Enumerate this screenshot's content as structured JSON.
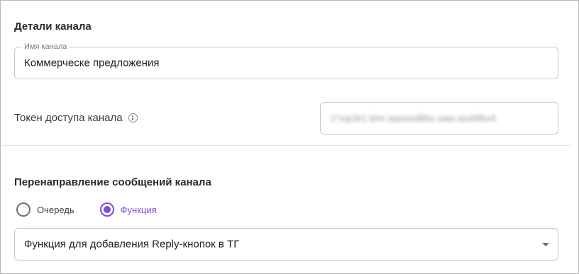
{
  "channel_details": {
    "title": "Детали канала",
    "name_field": {
      "label": "Имя канала",
      "value": "Коммерческе предложения"
    },
    "token": {
      "label": "Токен доступа канала",
      "info_icon": "info-icon",
      "masked_value": "1*xqr3r1 bhn aasoseBbs.uwe.asd4fbx4"
    }
  },
  "redirect": {
    "title": "Перенаправление сообщений канала",
    "options": [
      {
        "label": "Очередь",
        "selected": false
      },
      {
        "label": "Функция",
        "selected": true
      }
    ],
    "function_select": {
      "value": "Функция для добавления Reply-кнопок в ТГ",
      "icon": "chevron-down-icon"
    }
  },
  "colors": {
    "accent": "#7d4cdb",
    "border": "#c9c9c9",
    "text": "#1f1f1f"
  }
}
